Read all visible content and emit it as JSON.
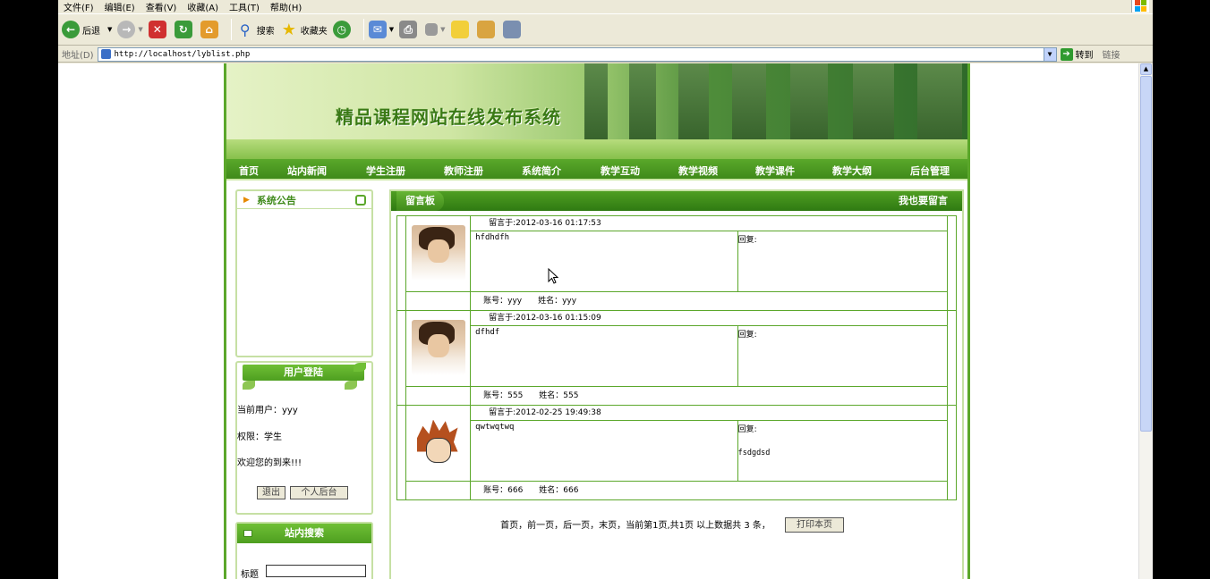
{
  "browser": {
    "menu": [
      "文件(F)",
      "编辑(E)",
      "查看(V)",
      "收藏(A)",
      "工具(T)",
      "帮助(H)"
    ],
    "toolbar": {
      "back_label": "后退",
      "search_label": "搜索",
      "favorites_label": "收藏夹"
    },
    "address": {
      "label": "地址(D)",
      "url": "http://localhost/lyblist.php",
      "go_label": "转到",
      "links_label": "链接"
    }
  },
  "site": {
    "title": "精品课程网站在线发布系统",
    "nav": [
      "首页",
      "站内新闻",
      "学生注册",
      "教师注册",
      "系统简介",
      "教学互动",
      "教学视频",
      "教学课件",
      "教学大纲",
      "后台管理"
    ],
    "notice": {
      "title": "系统公告"
    },
    "login": {
      "title": "用户登陆",
      "current_user": "当前用户：yyy",
      "role": "权限：学生",
      "welcome": "欢迎您的到来!!!",
      "logout_label": "退出",
      "personal_label": "个人后台"
    },
    "search": {
      "title": "站内搜索",
      "field_label": "标题"
    }
  },
  "board": {
    "title": "留言板",
    "post_link": "我也要留言",
    "messages": [
      {
        "meta": "留言于:2012-03-16 01:17:53",
        "content": "hfdhdfh",
        "reply_label": "回复:",
        "reply_text": "",
        "footer": "账号：yyy　　姓名：yyy",
        "avatar_icon": "boy-photo-avatar"
      },
      {
        "meta": "留言于:2012-03-16 01:15:09",
        "content": "dfhdf",
        "reply_label": "回复:",
        "reply_text": "",
        "footer": "账号：555　　姓名：555",
        "avatar_icon": "boy-photo-avatar"
      },
      {
        "meta": "留言于:2012-02-25 19:49:38",
        "content": "qwtwqtwq",
        "reply_label": "回复:",
        "reply_text": "fsdgdsd",
        "footer": "账号：666　　姓名：666",
        "avatar_icon": "cartoon-avatar"
      }
    ],
    "pager_text": "首页，前一页，后一页，末页，当前第1页,共1页 以上数据共 3 条，",
    "print_label": "打印本页"
  },
  "colors": {
    "site_green": "#5ba72b",
    "nav_green": "#3f8a1a",
    "light_border": "#c6e0a4",
    "xp_chrome": "#ece9d8"
  }
}
